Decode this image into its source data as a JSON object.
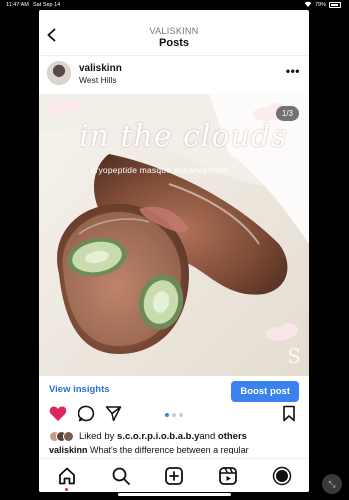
{
  "status_bar": {
    "time": "11:47 AM",
    "date": "Sat Sep 14",
    "battery": "79%"
  },
  "header": {
    "username_small": "VALISKINN",
    "title": "Posts"
  },
  "post": {
    "username": "valiskinn",
    "location": "West Hills",
    "image_counter": "1/3",
    "overlay_title": "in the clouds",
    "overlay_subtitle": "cryopeptide masque enhancement",
    "watermark": "S"
  },
  "actions": {
    "view_insights": "View insights",
    "boost_post": "Boost post"
  },
  "likes": {
    "prefix": "Liked by ",
    "user": "s.c.o.r.p.i.o.b.a.b.y",
    "middle": " and ",
    "others": "others"
  },
  "caption": {
    "username": "valiskinn",
    "text": " What's the difference between a regular"
  },
  "carousel": {
    "total": 3,
    "active": 1
  },
  "colors": {
    "accent": "#3b82f0",
    "like": "#e0245e",
    "link": "#2d6fd6"
  },
  "icons": [
    "back-icon",
    "more-icon",
    "heart-icon",
    "comment-icon",
    "share-icon",
    "bookmark-icon",
    "home-icon",
    "search-icon",
    "create-icon",
    "reels-icon",
    "profile-icon"
  ]
}
